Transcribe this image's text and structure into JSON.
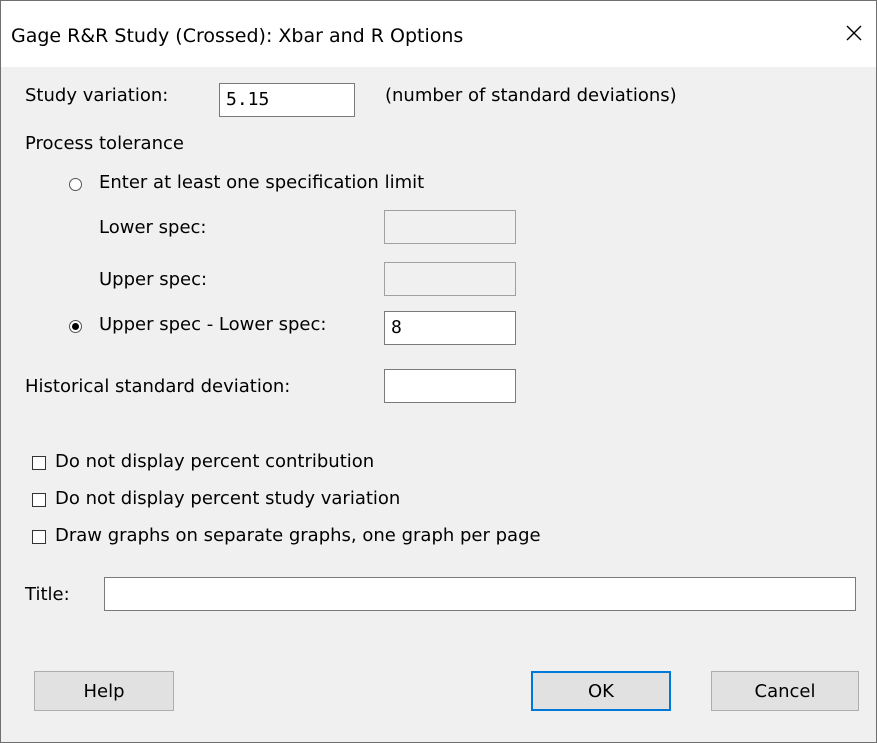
{
  "dialog": {
    "title": "Gage R&R Study (Crossed): Xbar and R Options",
    "close_glyph": "✕"
  },
  "study_variation": {
    "label": "Study variation:",
    "value": "5.15",
    "hint": "(number of standard deviations)"
  },
  "process_tolerance": {
    "heading": "Process tolerance",
    "option_spec_limit": {
      "label": "Enter at least one specification limit",
      "selected": false
    },
    "lower_spec": {
      "label": "Lower spec:",
      "value": ""
    },
    "upper_spec": {
      "label": "Upper spec:",
      "value": ""
    },
    "option_range": {
      "label": "Upper spec - Lower spec:",
      "selected": true,
      "value": "8"
    }
  },
  "historical_sd": {
    "label": "Historical standard deviation:",
    "value": ""
  },
  "options": [
    {
      "label": "Do not display percent contribution",
      "checked": false
    },
    {
      "label": "Do not display percent study variation",
      "checked": false
    },
    {
      "label": "Draw graphs on separate graphs, one graph per page",
      "checked": false
    }
  ],
  "title_field": {
    "label": "Title:",
    "value": ""
  },
  "buttons": {
    "help": "Help",
    "ok": "OK",
    "cancel": "Cancel"
  },
  "colors": {
    "default_button_border": "#0078d7",
    "face": "#f0f0f0"
  }
}
